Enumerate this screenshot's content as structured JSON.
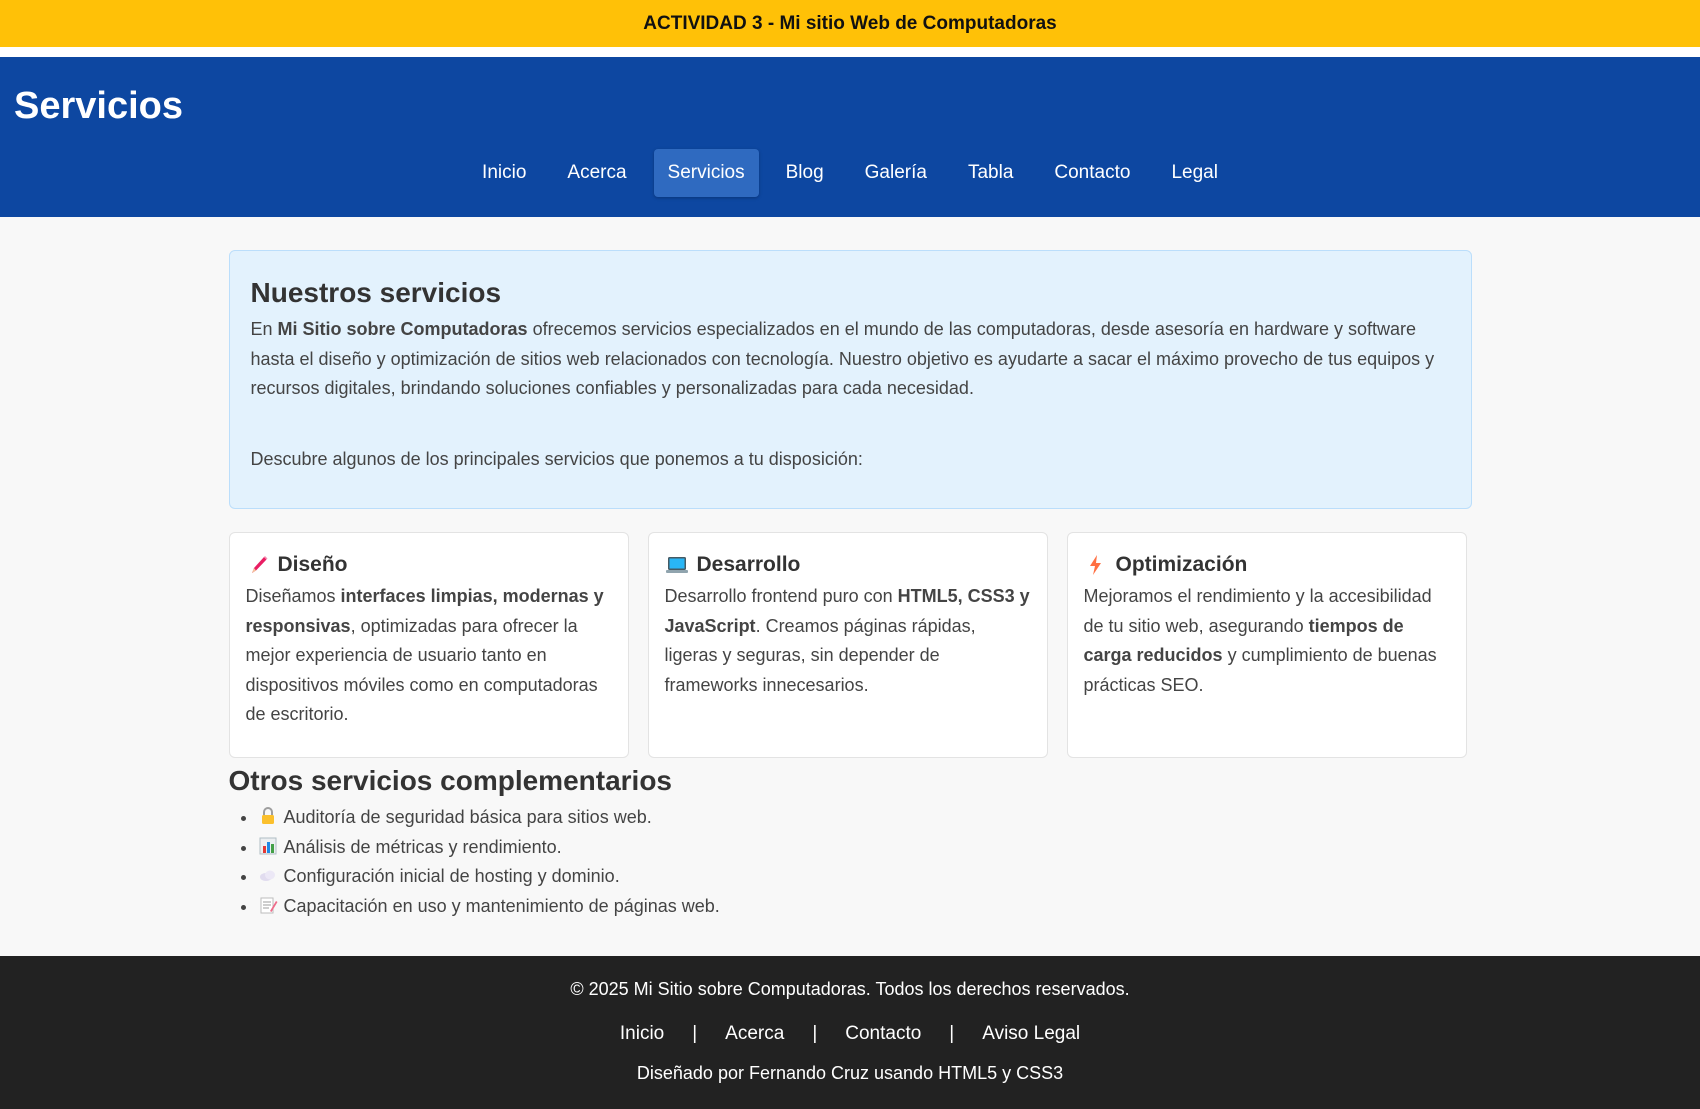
{
  "topbar": {
    "text": "ACTIVIDAD 3 - Mi sitio Web de Computadoras"
  },
  "header": {
    "title": "Servicios",
    "nav": [
      {
        "label": "Inicio",
        "active": false
      },
      {
        "label": "Acerca",
        "active": false
      },
      {
        "label": "Servicios",
        "active": true
      },
      {
        "label": "Blog",
        "active": false
      },
      {
        "label": "Galería",
        "active": false
      },
      {
        "label": "Tabla",
        "active": false
      },
      {
        "label": "Contacto",
        "active": false
      },
      {
        "label": "Legal",
        "active": false
      }
    ]
  },
  "intro": {
    "heading": "Nuestros servicios",
    "p1_before": "En ",
    "p1_bold": "Mi Sitio sobre Computadoras",
    "p1_after": " ofrecemos servicios especializados en el mundo de las computadoras, desde asesoría en hardware y software hasta el diseño y optimización de sitios web relacionados con tecnología. Nuestro objetivo es ayudarte a sacar el máximo provecho de tus equipos y recursos digitales, brindando soluciones confiables y personalizadas para cada necesidad.",
    "p2": "Descubre algunos de los principales servicios que ponemos a tu disposición:"
  },
  "cards": [
    {
      "icon": "pencil-icon",
      "title": "Diseño",
      "before": "Diseñamos ",
      "bold": "interfaces limpias, modernas y responsivas",
      "after": ", optimizadas para ofrecer la mejor experiencia de usuario tanto en dispositivos móviles como en computadoras de escritorio."
    },
    {
      "icon": "laptop-icon",
      "title": "Desarrollo",
      "before": "Desarrollo frontend puro con ",
      "bold": "HTML5, CSS3 y JavaScript",
      "after": ". Creamos páginas rápidas, ligeras y seguras, sin depender de frameworks innecesarios."
    },
    {
      "icon": "lightning-icon",
      "title": "Optimización",
      "before": "Mejoramos el rendimiento y la accesibilidad de tu sitio web, asegurando ",
      "bold": "tiempos de carga reducidos",
      "after": " y cumplimiento de buenas prácticas SEO."
    }
  ],
  "other": {
    "heading": "Otros servicios complementarios",
    "items": [
      {
        "icon": "lock-icon",
        "text": "Auditoría de seguridad básica para sitios web."
      },
      {
        "icon": "bar-chart-icon",
        "text": "Análisis de métricas y rendimiento."
      },
      {
        "icon": "cloud-icon",
        "text": "Configuración inicial de hosting y dominio."
      },
      {
        "icon": "memo-icon",
        "text": "Capacitación en uso y mantenimiento de páginas web."
      }
    ]
  },
  "footer": {
    "copyright": "© 2025 Mi Sitio sobre Computadoras. Todos los derechos reservados.",
    "links": [
      "Inicio",
      "Acerca",
      "Contacto",
      "Aviso Legal"
    ],
    "separator": "|",
    "credit": "Diseñado por Fernando Cruz usando HTML5 y CSS3"
  },
  "colors": {
    "topbar_bg": "#ffc107",
    "header_bg": "#0d47a1",
    "nav_active_bg": "#2f6ac0",
    "intro_bg": "#e3f2fd",
    "footer_bg": "#222222"
  }
}
